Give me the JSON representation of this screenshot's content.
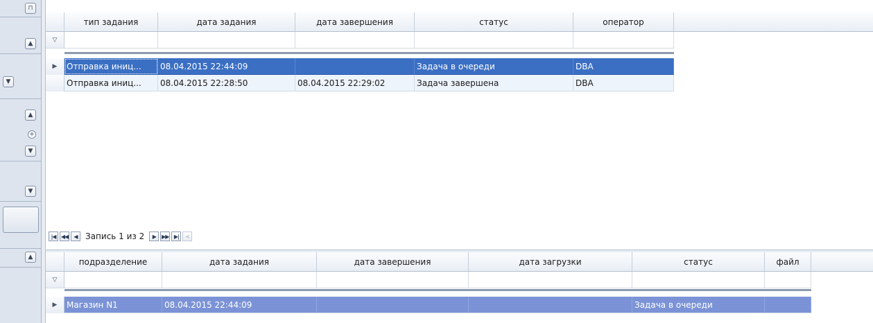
{
  "top_grid": {
    "columns": [
      "тип задания",
      "дата задания",
      "дата завершения",
      "статус",
      "оператор"
    ],
    "rows": [
      [
        "Отправка иниц...",
        "08.04.2015 22:44:09",
        "",
        "Задача в очереди",
        "DBA"
      ],
      [
        "Отправка иниц...",
        "08.04.2015 22:28:50",
        "08.04.2015 22:29:02",
        "Задача завершена",
        "DBA"
      ]
    ]
  },
  "navigator": {
    "record_text": "Запись 1 из 2"
  },
  "bottom_grid": {
    "columns": [
      "подразделение",
      "дата задания",
      "дата завершения",
      "дата загрузки",
      "статус",
      "файл"
    ],
    "rows": [
      [
        "Магазин N1",
        "08.04.2015 22:44:09",
        "",
        "",
        "Задача в очереди",
        ""
      ]
    ]
  },
  "icons": {
    "pin": "pin-icon",
    "collapse": "chevron-up-icon",
    "expand": "chevron-down-icon",
    "filter": "filter-icon",
    "row_indicator": "triangle-right-icon"
  },
  "colors": {
    "selection": "#3a6fc4",
    "bottom_selection": "#7b93d6",
    "alt_row": "#eef4fb"
  }
}
